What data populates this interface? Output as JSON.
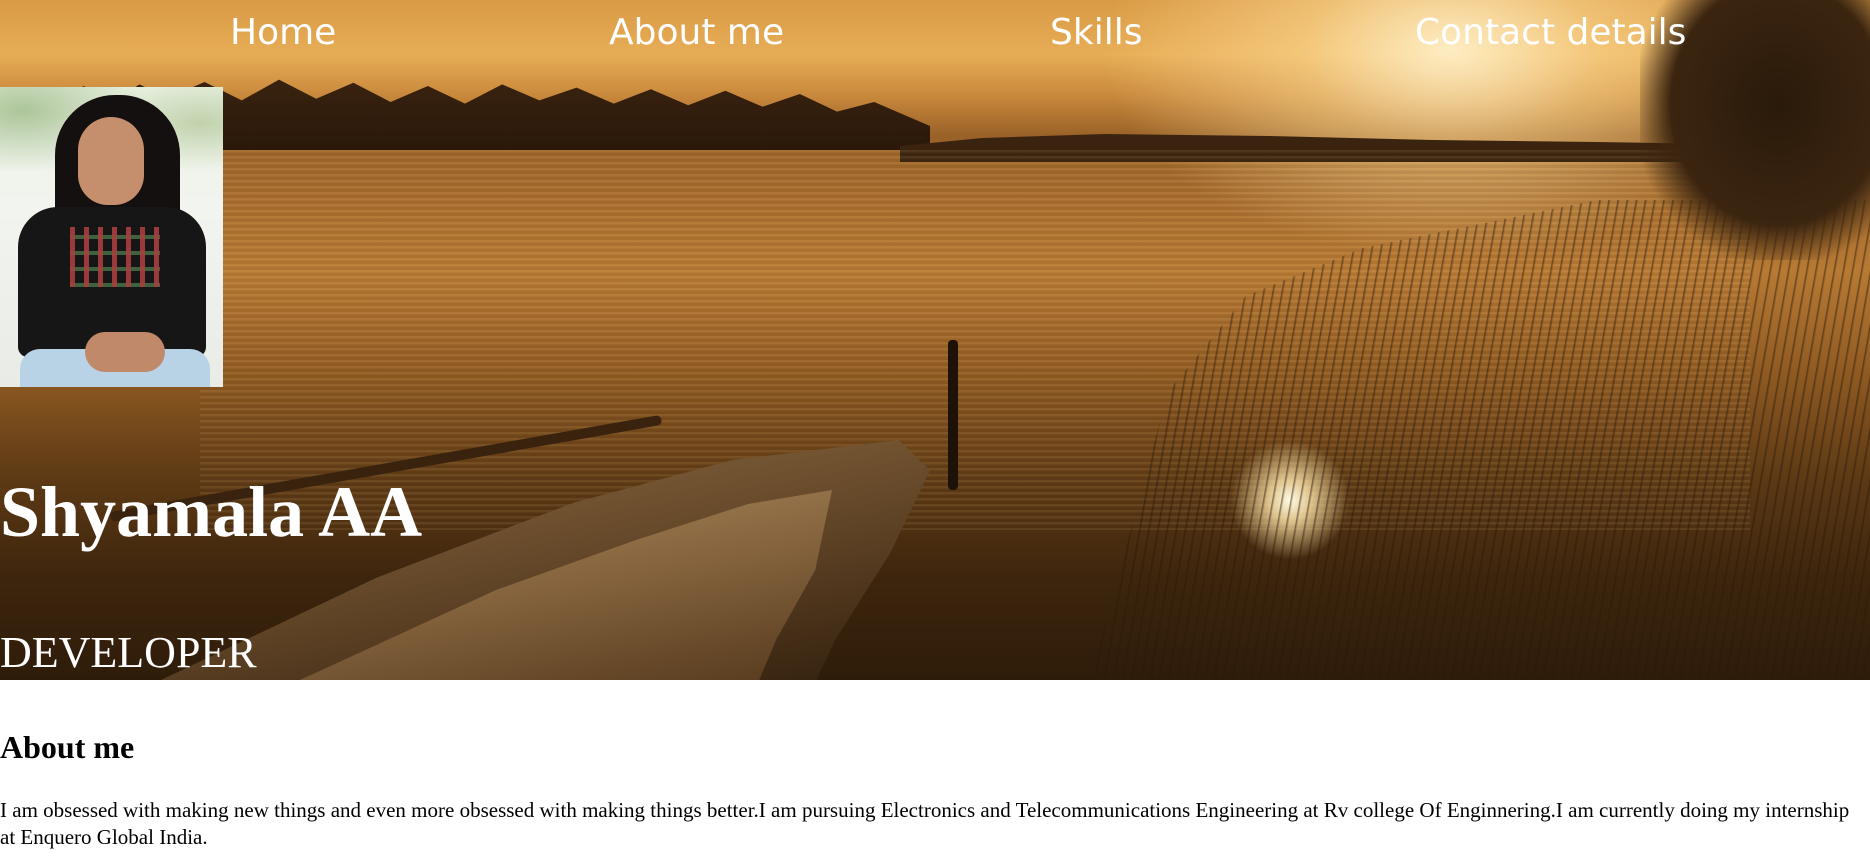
{
  "nav": {
    "items": [
      {
        "label": "Home"
      },
      {
        "label": "About me"
      },
      {
        "label": "Skills"
      },
      {
        "label": "Contact details"
      }
    ]
  },
  "hero": {
    "name": "Shyamala AA",
    "role": "DEVELOPER"
  },
  "about": {
    "title": "About me",
    "text": "I am obsessed with making new things and even more obsessed with making things better.I am pursuing Electronics and Telecommunications Engineering at Rv college Of Enginnering.I am currently doing my internship at Enquero Global India."
  },
  "colors": {
    "nav_text": "#ffffff",
    "hero_text": "#ffffff",
    "body_text": "#000000"
  }
}
